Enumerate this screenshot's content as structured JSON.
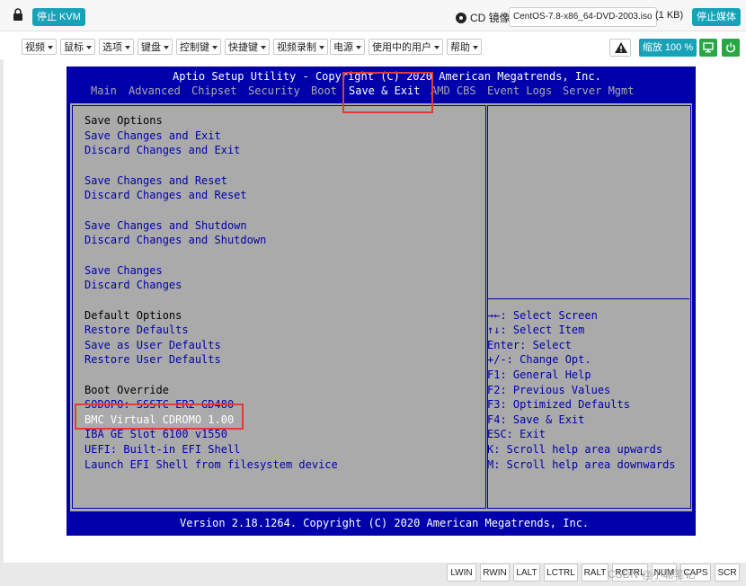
{
  "topbar": {
    "stop_kvm": "停止 KVM",
    "cd_label": "CD 镜像:",
    "iso_name": "CentOS-7.8-x86_64-DVD-2003.iso",
    "iso_size": "(1 KB)",
    "stop_media": "停止媒体"
  },
  "menubar": {
    "items": [
      "视频",
      "鼠标",
      "选项",
      "键盘",
      "控制键",
      "快捷键",
      "视频录制",
      "电源",
      "使用中的用户",
      "帮助"
    ],
    "zoom": "缩放 100 %"
  },
  "bios": {
    "title": "Aptio Setup Utility - Copyright (C) 2020 American Megatrends, Inc.",
    "tabs": [
      "Main",
      "Advanced",
      "Chipset",
      "Security",
      "Boot",
      "Save & Exit",
      "AMD CBS",
      "Event Logs",
      "Server Mgmt"
    ],
    "active_tab": "Save & Exit",
    "options": [
      "Save Options",
      "Save Changes and Exit",
      "Discard Changes and Exit",
      "Save Changes and Reset",
      "Discard Changes and Reset",
      "Save Changes and Shutdown",
      "Discard Changes and Shutdown",
      "Save Changes",
      "Discard Changes",
      "Default Options",
      "Restore Defaults",
      "Save as User Defaults",
      "Restore User Defaults",
      "Boot Override",
      "SODOPO: SSSTC ER2-GD480",
      "BMC Virtual CDROMO 1.00",
      "IBA GE Slot 6100 v1550",
      "UEFI: Built-in EFI Shell",
      "Launch EFI Shell from filesystem device"
    ],
    "help": [
      "→←: Select Screen",
      "↑↓: Select Item",
      "Enter: Select",
      "+/-: Change Opt.",
      "F1: General Help",
      "F2: Previous Values",
      "F3: Optimized Defaults",
      "F4: Save & Exit",
      "ESC: Exit",
      "K: Scroll help area upwards",
      "M: Scroll help area downwards"
    ],
    "footer": "Version 2.18.1264. Copyright (C) 2020 American Megatrends, Inc."
  },
  "statusbar": {
    "keys": [
      "LWIN",
      "RWIN",
      "LALT",
      "LCTRL",
      "RALT",
      "RCTRL",
      "NUM",
      "CAPS",
      "SCR"
    ]
  },
  "watermark": "CSDN @小聪笔记"
}
